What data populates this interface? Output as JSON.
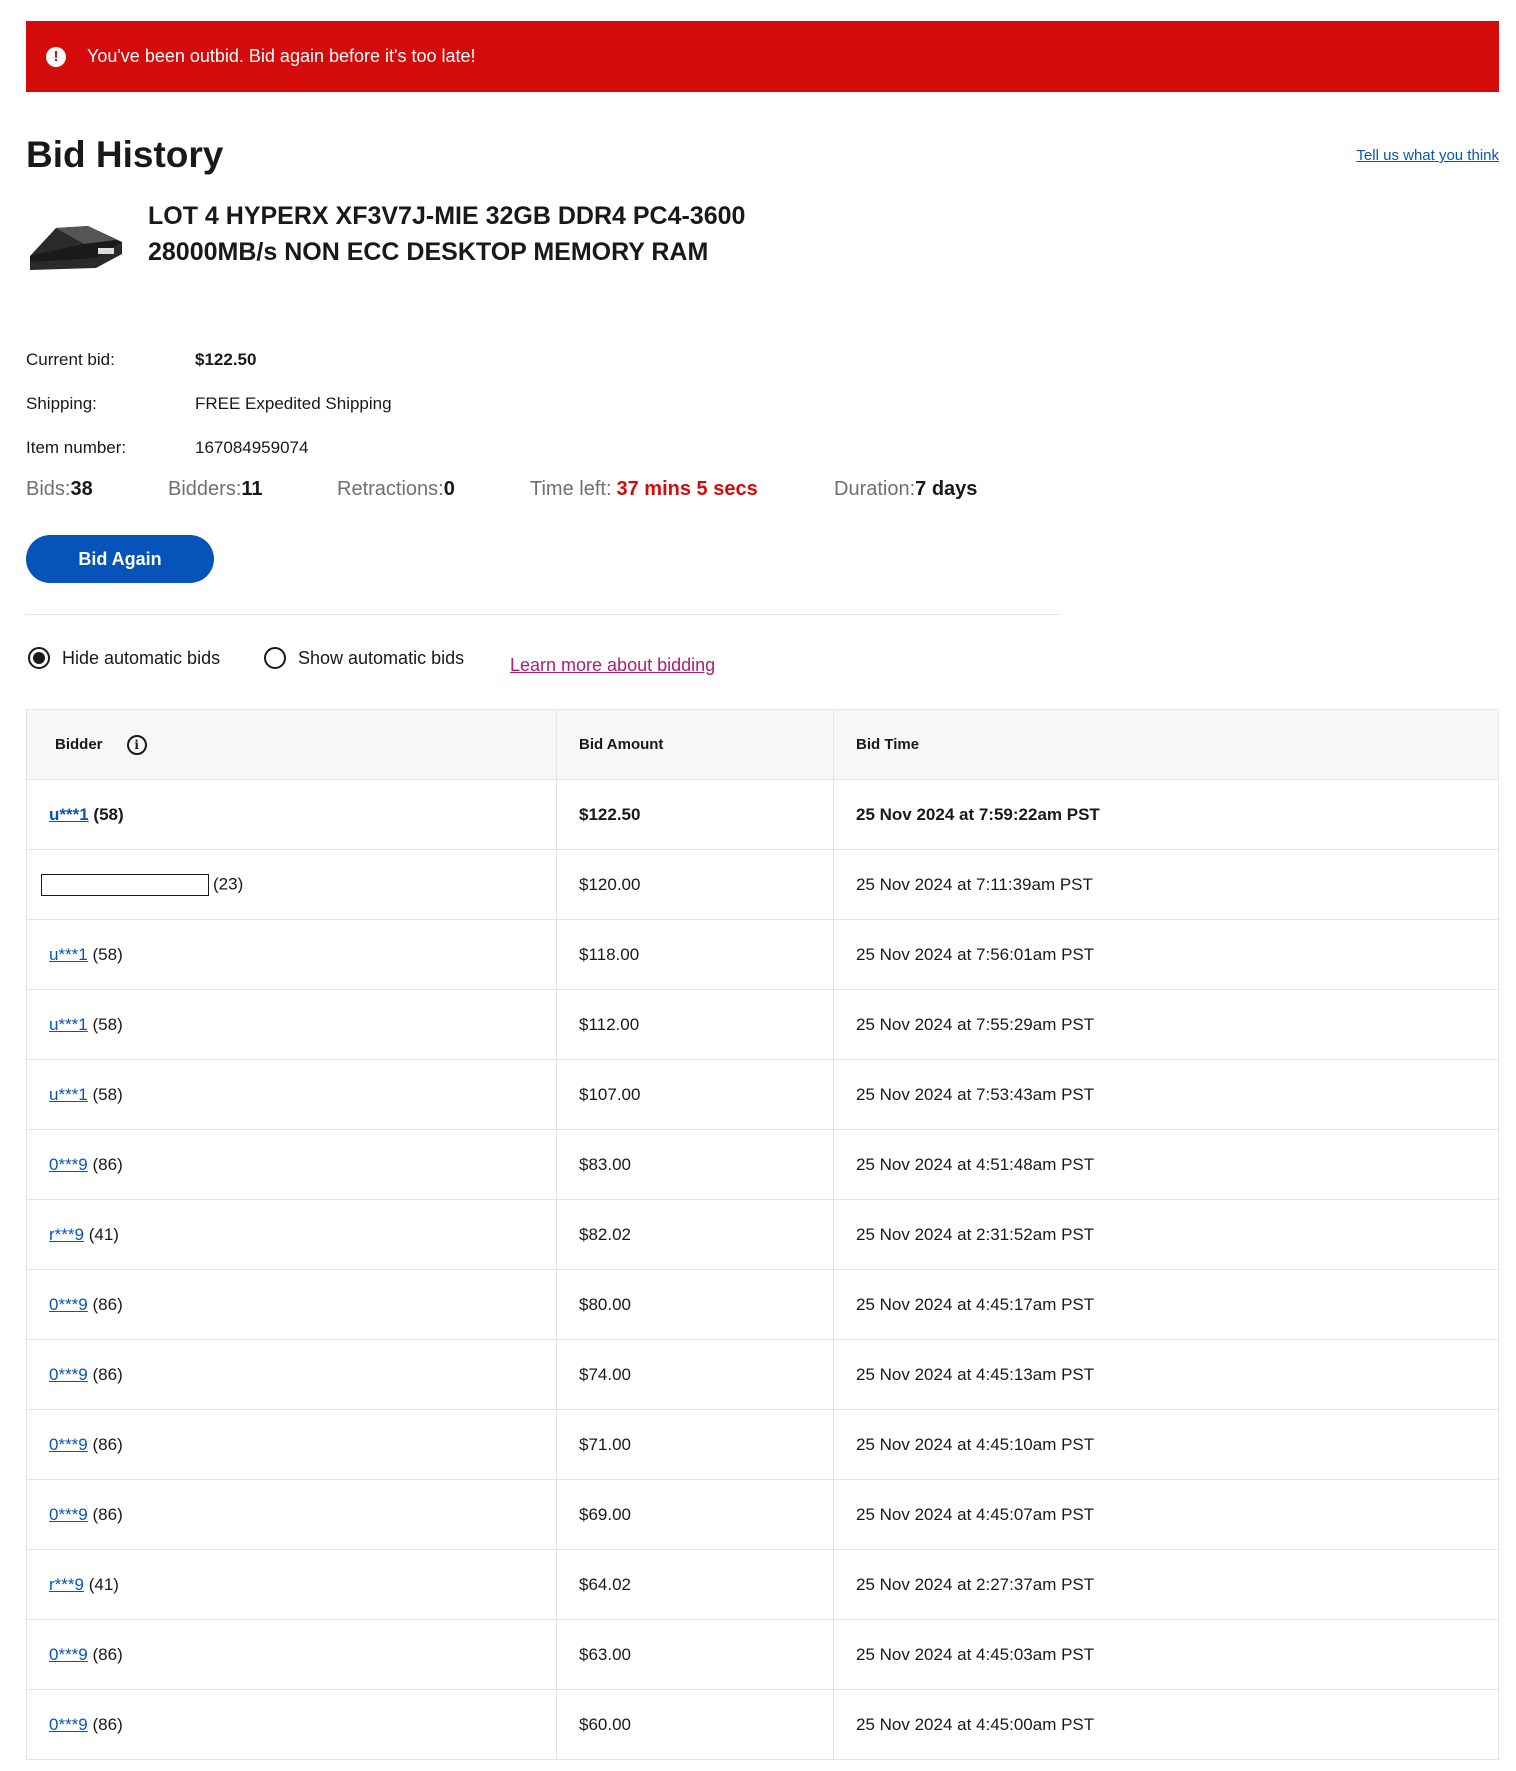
{
  "alert": {
    "message": "You've been outbid. Bid again before it's too late!",
    "icon": "exclamation-circle-icon",
    "color": "#d50b0b"
  },
  "header": {
    "title": "Bid History",
    "feedback_link": "Tell us what you think"
  },
  "item": {
    "title": "LOT 4 HYPERX XF3V7J-MIE 32GB DDR4 PC4-3600 28000MB/s NON ECC DESKTOP MEMORY RAM"
  },
  "details": {
    "current_bid_label": "Current bid:",
    "current_bid_value": "$122.50",
    "shipping_label": "Shipping:",
    "shipping_value": "FREE Expedited Shipping",
    "item_number_label": "Item number:",
    "item_number_value": "167084959074"
  },
  "stats": {
    "bids_label": "Bids:",
    "bids_value": "38",
    "bidders_label": "Bidders:",
    "bidders_value": "11",
    "retractions_label": "Retractions:",
    "retractions_value": "0",
    "time_left_label": "Time left:",
    "time_left_value": "37 mins 5 secs",
    "duration_label": "Duration:",
    "duration_value": "7 days"
  },
  "actions": {
    "bid_again": "Bid Again"
  },
  "filters": {
    "hide_auto": "Hide automatic bids",
    "show_auto": "Show automatic bids",
    "learn_more": "Learn more about bidding"
  },
  "table": {
    "headers": {
      "bidder": "Bidder",
      "amount": "Bid Amount",
      "time": "Bid Time"
    },
    "rows": [
      {
        "bidder": "u***1",
        "score": "(58)",
        "amount": "$122.50",
        "time": "25 Nov 2024 at 7:59:22am PST"
      },
      {
        "bidder": "",
        "score": "(23)",
        "amount": "$120.00",
        "time": "25 Nov 2024 at 7:11:39am PST"
      },
      {
        "bidder": "u***1",
        "score": "(58)",
        "amount": "$118.00",
        "time": "25 Nov 2024 at 7:56:01am PST"
      },
      {
        "bidder": "u***1",
        "score": "(58)",
        "amount": "$112.00",
        "time": "25 Nov 2024 at 7:55:29am PST"
      },
      {
        "bidder": "u***1",
        "score": "(58)",
        "amount": "$107.00",
        "time": "25 Nov 2024 at 7:53:43am PST"
      },
      {
        "bidder": "0***9",
        "score": "(86)",
        "amount": "$83.00",
        "time": "25 Nov 2024 at 4:51:48am PST"
      },
      {
        "bidder": "r***9",
        "score": "(41)",
        "amount": "$82.02",
        "time": "25 Nov 2024 at 2:31:52am PST"
      },
      {
        "bidder": "0***9",
        "score": "(86)",
        "amount": "$80.00",
        "time": "25 Nov 2024 at 4:45:17am PST"
      },
      {
        "bidder": "0***9",
        "score": "(86)",
        "amount": "$74.00",
        "time": "25 Nov 2024 at 4:45:13am PST"
      },
      {
        "bidder": "0***9",
        "score": "(86)",
        "amount": "$71.00",
        "time": "25 Nov 2024 at 4:45:10am PST"
      },
      {
        "bidder": "0***9",
        "score": "(86)",
        "amount": "$69.00",
        "time": "25 Nov 2024 at 4:45:07am PST"
      },
      {
        "bidder": "r***9",
        "score": "(41)",
        "amount": "$64.02",
        "time": "25 Nov 2024 at 2:27:37am PST"
      },
      {
        "bidder": "0***9",
        "score": "(86)",
        "amount": "$63.00",
        "time": "25 Nov 2024 at 4:45:03am PST"
      },
      {
        "bidder": "0***9",
        "score": "(86)",
        "amount": "$60.00",
        "time": "25 Nov 2024 at 4:45:00am PST"
      }
    ]
  }
}
